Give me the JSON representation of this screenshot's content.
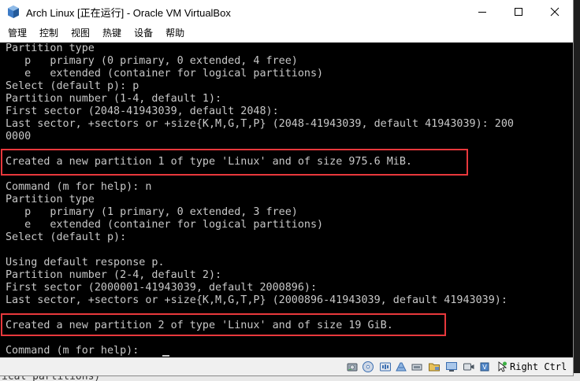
{
  "window": {
    "title": "Arch Linux [正在运行] - Oracle VM VirtualBox",
    "minimize_symbol": "—",
    "maximize_symbol": "☐",
    "close_symbol": "✕"
  },
  "menu": [
    "管理",
    "控制",
    "视图",
    "热键",
    "设备",
    "帮助"
  ],
  "console": {
    "lines": [
      "Partition type",
      "   p   primary (0 primary, 0 extended, 4 free)",
      "   e   extended (container for logical partitions)",
      "Select (default p): p",
      "Partition number (1-4, default 1):",
      "First sector (2048-41943039, default 2048):",
      "Last sector, +sectors or +size{K,M,G,T,P} (2048-41943039, default 41943039): 200",
      "0000",
      "",
      "Created a new partition 1 of type 'Linux' and of size 975.6 MiB.",
      "",
      "Command (m for help): n",
      "Partition type",
      "   p   primary (1 primary, 0 extended, 3 free)",
      "   e   extended (container for logical partitions)",
      "Select (default p):",
      "",
      "Using default response p.",
      "Partition number (2-4, default 2):",
      "First sector (2000001-41943039, default 2000896):",
      "Last sector, +sectors or +size{K,M,G,T,P} (2000896-41943039, default 41943039):",
      "",
      "Created a new partition 2 of type 'Linux' and of size 19 GiB.",
      "",
      "Command (m for help): "
    ]
  },
  "statusbar": {
    "host_key": "Right Ctrl",
    "icons": [
      "hard-disk-icon",
      "optical-disc-icon",
      "audio-icon",
      "network-icon",
      "usb-icon",
      "shared-folders-icon",
      "display-icon",
      "video-capture-icon",
      "cpu-icon",
      "mouse-integration-icon",
      "keyboard-capture-icon"
    ]
  },
  "background": {
    "partial_text": "ical partitions)"
  },
  "colors": {
    "highlight": "#e8383c",
    "console_text": "#c8c8c8",
    "console_bg": "#000000"
  }
}
